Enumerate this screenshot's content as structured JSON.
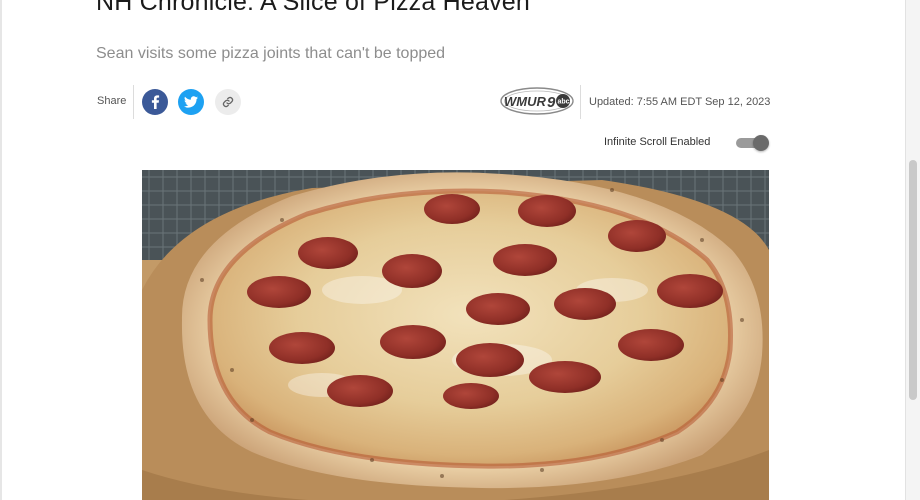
{
  "article": {
    "headline": "NH Chronicle: A Slice of Pizza Heaven",
    "subheadline": "Sean visits some pizza joints that can't be topped"
  },
  "share": {
    "label": "Share",
    "buttons": [
      {
        "name": "facebook",
        "icon": "facebook-icon",
        "color": "#3b5998"
      },
      {
        "name": "twitter",
        "icon": "twitter-icon",
        "color": "#1da1f2"
      },
      {
        "name": "copy-link",
        "icon": "link-icon",
        "color": "#ececec"
      }
    ]
  },
  "station": {
    "logo_text": "WMUR",
    "channel": "9",
    "network": "abc"
  },
  "meta": {
    "updated": "Updated: 7:55 AM EDT Sep 12, 2023"
  },
  "infinite_scroll": {
    "label": "Infinite Scroll Enabled",
    "enabled": true
  },
  "colors": {
    "headline": "#1b1b1b",
    "subheadline": "#8d8d8d",
    "facebook": "#3b5998",
    "twitter": "#1da1f2"
  },
  "hero_image": {
    "subject": "pepperoni pizza"
  }
}
